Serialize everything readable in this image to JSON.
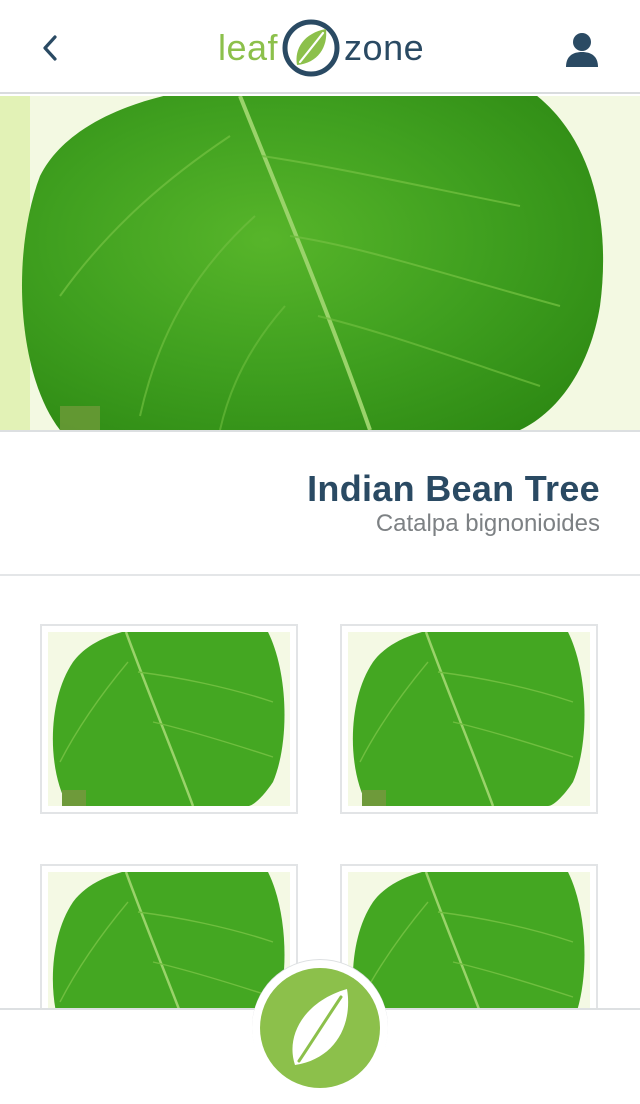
{
  "app": {
    "logo_word_left": "leaf",
    "logo_word_right": "zone"
  },
  "plant": {
    "common_name": "Indian Bean Tree",
    "scientific_name": "Catalpa bignonioides"
  },
  "icons": {
    "back": "chevron-left-icon",
    "user": "user-icon",
    "identify": "leaf-icon"
  },
  "colors": {
    "brand_green": "#8cc04b",
    "brand_navy": "#2a4a63",
    "subtitle_gray": "#7d8184"
  }
}
